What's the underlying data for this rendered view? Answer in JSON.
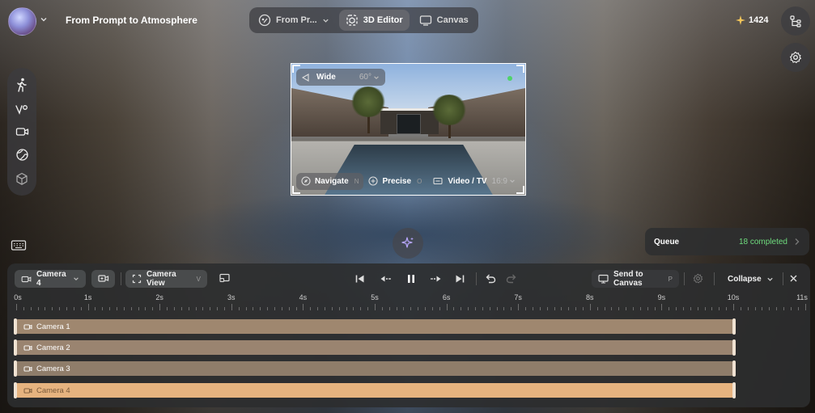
{
  "header": {
    "project_title": "From Prompt to Atmosphere",
    "nav": [
      {
        "label": "From Pr...",
        "icon": "palette-icon"
      },
      {
        "label": "3D Editor",
        "icon": "3d-cube-icon"
      },
      {
        "label": "Canvas",
        "icon": "canvas-icon"
      }
    ],
    "credits": "1424"
  },
  "viewport": {
    "lens_label": "Wide",
    "fov": "60°",
    "modes": [
      {
        "label": "Navigate",
        "key": "N"
      },
      {
        "label": "Precise",
        "key": "O"
      }
    ],
    "aspect_label": "Video / TV",
    "aspect_ratio": "16:9"
  },
  "queue": {
    "label": "Queue",
    "status": "18 completed",
    "status_color": "#6fdc7e"
  },
  "timeline": {
    "camera_select": "Camera 4",
    "camera_view_label": "Camera View",
    "camera_view_key": "V",
    "send_label": "Send to Canvas",
    "send_key": "P",
    "collapse_label": "Collapse",
    "ruler": [
      "0s",
      "1s",
      "2s",
      "3s",
      "4s",
      "5s",
      "6s",
      "7s",
      "8s",
      "9s",
      "10s",
      "11s"
    ],
    "tracks": [
      {
        "label": "Camera 1",
        "color": "#9f876f"
      },
      {
        "label": "Camera 2",
        "color": "#9a8470"
      },
      {
        "label": "Camera 3",
        "color": "#8f7d6a"
      },
      {
        "label": "Camera 4",
        "color": "#e6b37f"
      }
    ]
  }
}
